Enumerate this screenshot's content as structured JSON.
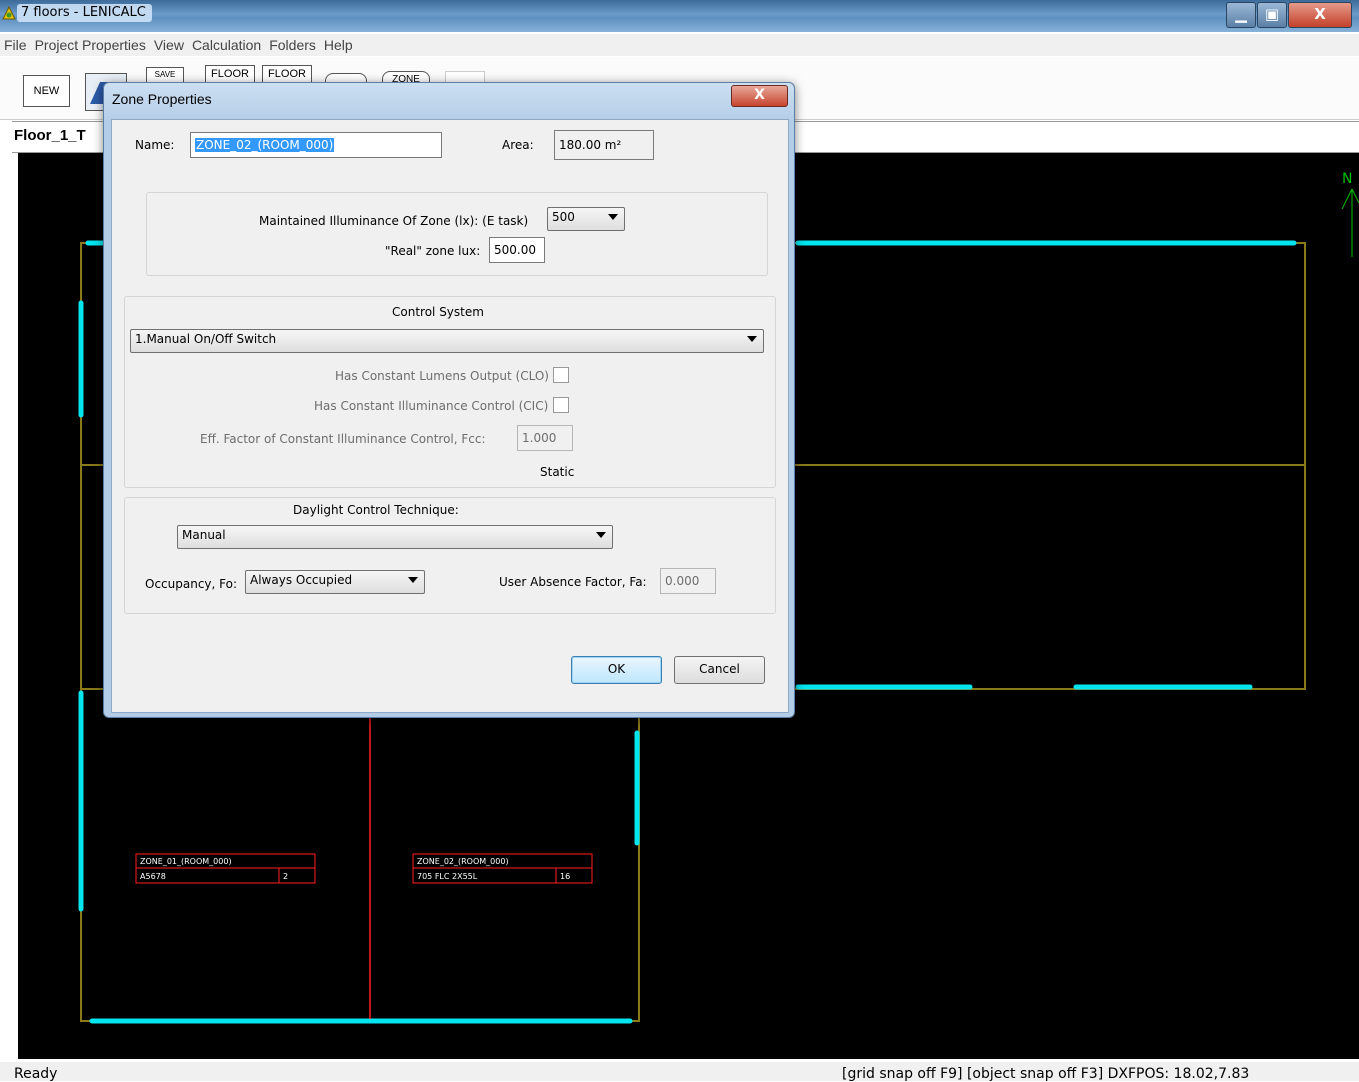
{
  "window": {
    "title": "7 floors - LENICALC",
    "minimize_glyph": "▁",
    "maximize_glyph": "▣",
    "close_glyph": "X"
  },
  "menu": [
    "File",
    "Project Properties",
    "View",
    "Calculation",
    "Folders",
    "Help"
  ],
  "toolbar": {
    "new_label": "NEW",
    "save_label": "SAVE",
    "floor1_label": "FLOOR",
    "floor2_label": "FLOOR",
    "zone_label": "ZONE"
  },
  "tab": {
    "label": "Floor_1_T"
  },
  "dialog": {
    "title": "Zone Properties",
    "close_glyph": "X",
    "name_label": "Name:",
    "name_value": "ZONE_02_(ROOM_000)",
    "area_label": "Area:",
    "area_value": "180.00 m²",
    "illuminance_label": "Maintained Illuminance Of Zone (lx): (E task)",
    "illuminance_value": "500",
    "real_lux_label": "\"Real\" zone lux:",
    "real_lux_value": "500.00",
    "control_system_title": "Control System",
    "control_system_value": "1.Manual On/Off Switch",
    "clo_label": "Has Constant Lumens Output (CLO)",
    "clo_checked": false,
    "cic_label": "Has Constant Illuminance Control (CIC)",
    "cic_checked": false,
    "fcc_label": "Eff. Factor of Constant Illuminance Control, Fcc:",
    "fcc_value": "1.000",
    "static_label": "Static",
    "daylight_title": "Daylight Control Technique:",
    "daylight_value": "Manual",
    "occupancy_label": "Occupancy, Fo:",
    "occupancy_value": "Always Occupied",
    "absence_label": "User Absence Factor, Fa:",
    "absence_value": "0.000",
    "ok_label": "OK",
    "cancel_label": "Cancel"
  },
  "plan": {
    "zone1_name": "ZONE_01_(ROOM_000)",
    "zone1_lamp": "A5678",
    "zone1_count": "2",
    "zone2_name": "ZONE_02_(ROOM_000)",
    "zone2_lamp": "705 FLC 2X55L",
    "zone2_count": "16",
    "north_label": "N"
  },
  "status": {
    "left": "Ready",
    "right": "[grid snap off F9] [object snap off F3]   DXFPOS: 18.02,7.83"
  },
  "colors": {
    "wall": "#8a7a1a",
    "window": "#00e5ee",
    "zone_divider": "#ff2020",
    "label_border": "#ff2020",
    "north_arrow": "#00c000"
  }
}
